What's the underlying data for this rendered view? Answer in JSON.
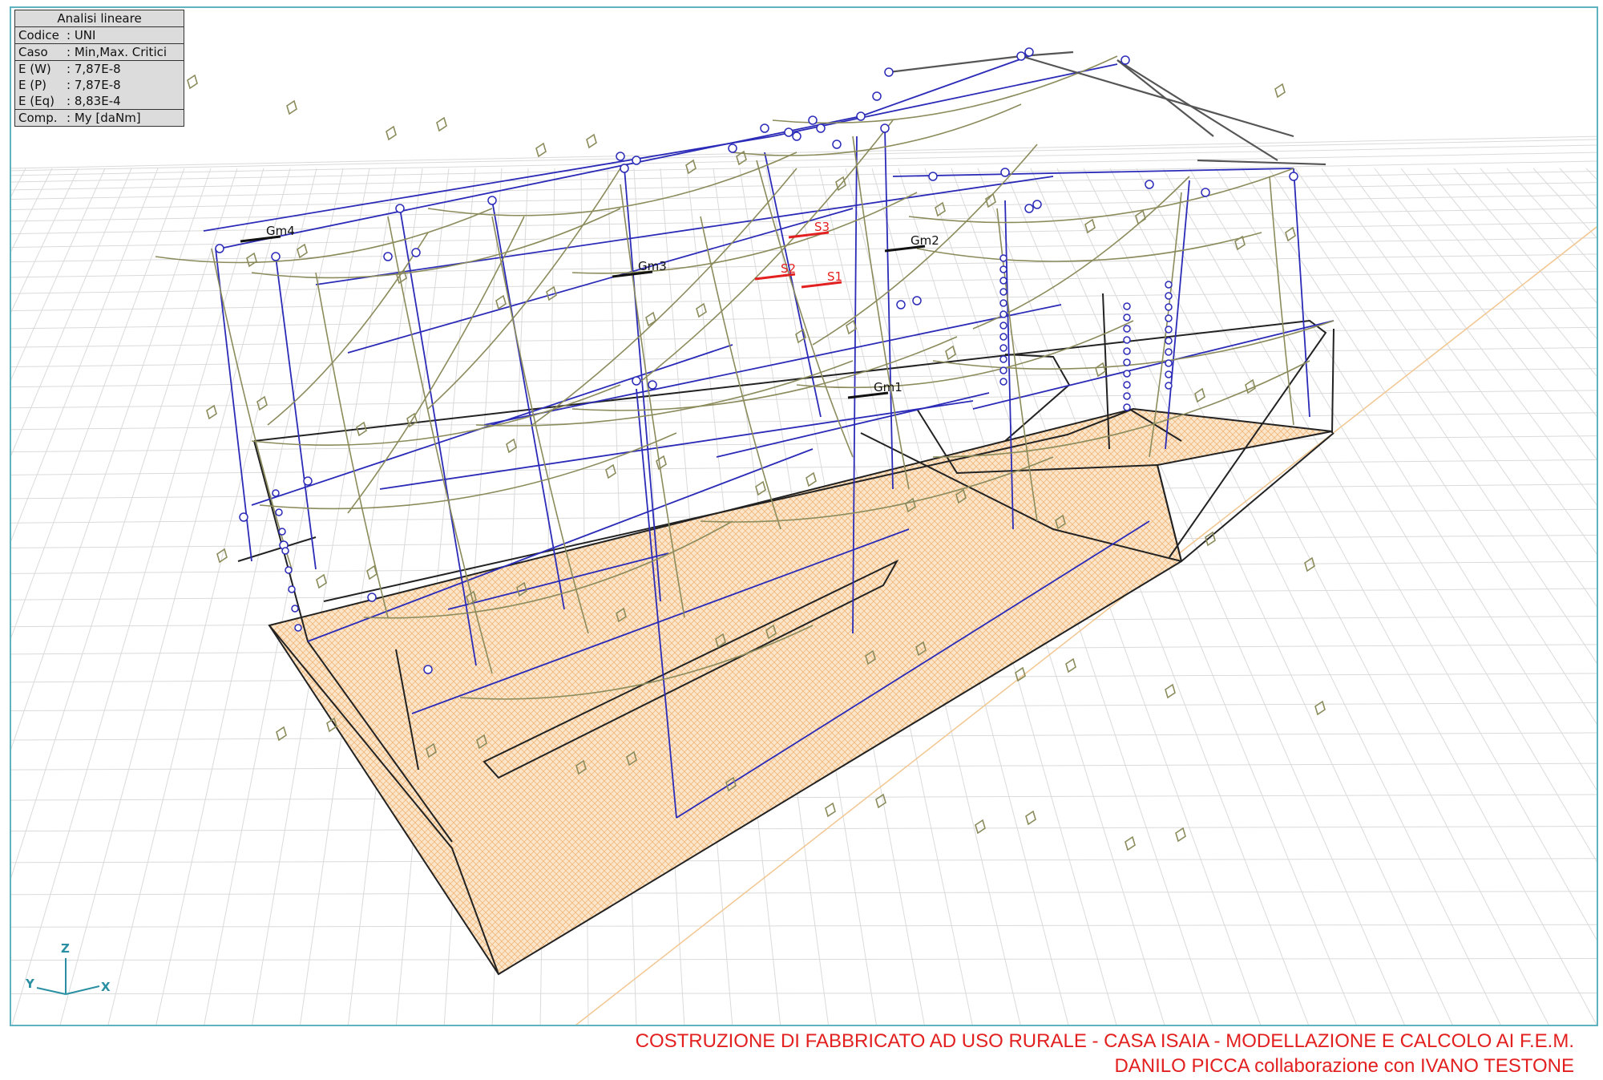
{
  "info_panel": {
    "title": "Analisi lineare",
    "rows": [
      {
        "key": "Codice",
        "value": ": UNI"
      },
      {
        "key": "Caso",
        "value": ": Min,Max. Critici"
      },
      {
        "key": "E (W)",
        "value": ": 7,87E-8"
      },
      {
        "key": "E (P)",
        "value": ": 7,87E-8"
      },
      {
        "key": "E (Eq)",
        "value": ": 8,83E-4"
      },
      {
        "key": "Comp.",
        "value": ": My [daNm]"
      }
    ]
  },
  "model_labels": {
    "gm1": "Gm1",
    "gm2": "Gm2",
    "gm3": "Gm3",
    "gm4": "Gm4",
    "s1": "S1",
    "s2": "S2",
    "s3": "S3"
  },
  "axis": {
    "z": "Z",
    "y": "Y",
    "x": "X"
  },
  "footer": {
    "line1": "COSTRUZIONE DI FABBRICATO AD USO RURALE - CASA ISAIA - MODELLAZIONE E CALCOLO AI F.E.M.",
    "line2": "DANILO PICCA collaborazione con IVANO TESTONE"
  },
  "colors": {
    "frame": "#5fb3c1",
    "beam_blue": "#2b2bb8",
    "diagram_olive": "#8a8a5a",
    "foundation_fill": "#f7d9b5",
    "grid": "#d6d6d6",
    "axis_cyan": "#2a8fa3",
    "footer_red": "#e32020",
    "label_red": "#e32020"
  }
}
